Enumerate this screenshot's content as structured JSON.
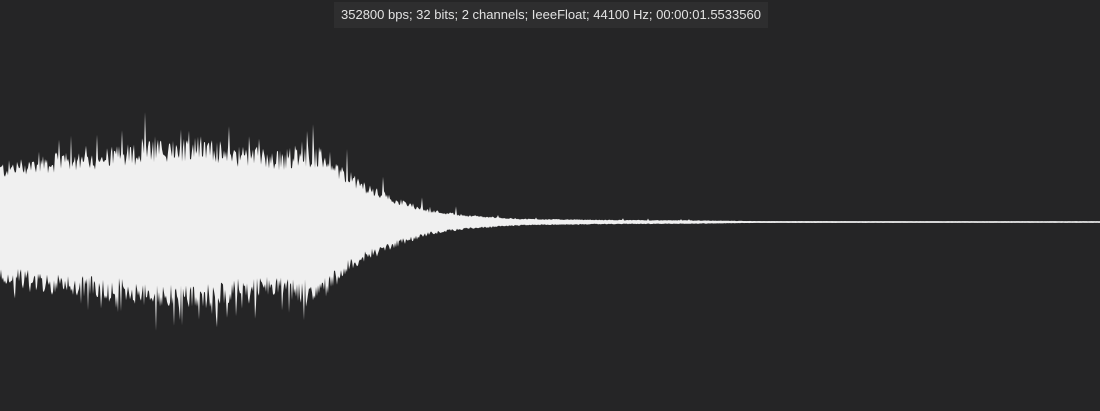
{
  "audio_info": {
    "summary": "352800 bps; 32 bits; 2 channels; IeeeFloat; 44100 Hz; 00:00:01.5533560"
  },
  "waveform": {
    "fill_color": "#f0f0f0",
    "background_color": "#252526"
  }
}
